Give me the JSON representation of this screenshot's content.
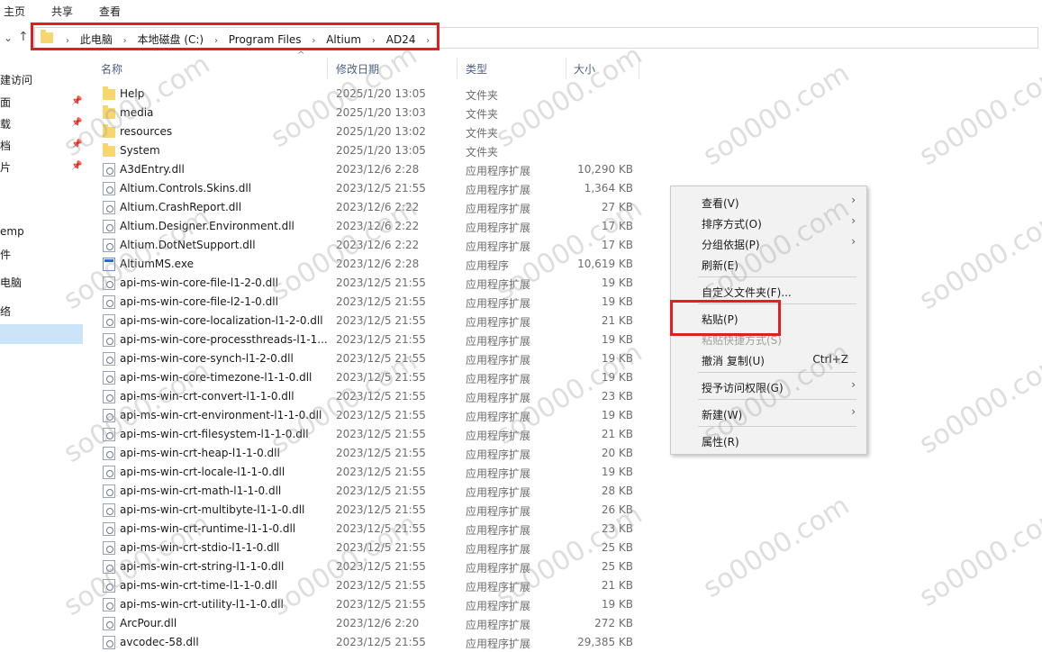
{
  "ribbon": {
    "tabs": [
      "主页",
      "共享",
      "查看"
    ]
  },
  "address": {
    "crumbs": [
      "此电脑",
      "本地磁盘 (C:)",
      "Program Files",
      "Altium",
      "AD24"
    ]
  },
  "nav_quick": [
    "建访问",
    "面",
    "载",
    "档",
    "片",
    "",
    "",
    "emp",
    "件"
  ],
  "nav_this_pc": "电脑",
  "nav_net": "络",
  "columns": {
    "name": "名称",
    "date": "修改日期",
    "type": "类型",
    "size": "大小"
  },
  "files": [
    {
      "name": "Help",
      "date": "2025/1/20 13:05",
      "type": "文件夹",
      "size": "",
      "icon": "folder"
    },
    {
      "name": "media",
      "date": "2025/1/20 13:03",
      "type": "文件夹",
      "size": "",
      "icon": "folder"
    },
    {
      "name": "resources",
      "date": "2025/1/20 13:02",
      "type": "文件夹",
      "size": "",
      "icon": "folder"
    },
    {
      "name": "System",
      "date": "2025/1/20 13:05",
      "type": "文件夹",
      "size": "",
      "icon": "folder"
    },
    {
      "name": "A3dEntry.dll",
      "date": "2023/12/6 2:28",
      "type": "应用程序扩展",
      "size": "10,290 KB",
      "icon": "dll"
    },
    {
      "name": "Altium.Controls.Skins.dll",
      "date": "2023/12/5 21:55",
      "type": "应用程序扩展",
      "size": "1,364 KB",
      "icon": "dll"
    },
    {
      "name": "Altium.CrashReport.dll",
      "date": "2023/12/6 2:22",
      "type": "应用程序扩展",
      "size": "27 KB",
      "icon": "dll"
    },
    {
      "name": "Altium.Designer.Environment.dll",
      "date": "2023/12/6 2:22",
      "type": "应用程序扩展",
      "size": "17 KB",
      "icon": "dll"
    },
    {
      "name": "Altium.DotNetSupport.dll",
      "date": "2023/12/6 2:22",
      "type": "应用程序扩展",
      "size": "17 KB",
      "icon": "dll"
    },
    {
      "name": "AltiumMS.exe",
      "date": "2023/12/6 2:28",
      "type": "应用程序",
      "size": "10,619 KB",
      "icon": "exe"
    },
    {
      "name": "api-ms-win-core-file-l1-2-0.dll",
      "date": "2023/12/5 21:55",
      "type": "应用程序扩展",
      "size": "19 KB",
      "icon": "dll"
    },
    {
      "name": "api-ms-win-core-file-l2-1-0.dll",
      "date": "2023/12/5 21:55",
      "type": "应用程序扩展",
      "size": "19 KB",
      "icon": "dll"
    },
    {
      "name": "api-ms-win-core-localization-l1-2-0.dll",
      "date": "2023/12/5 21:55",
      "type": "应用程序扩展",
      "size": "21 KB",
      "icon": "dll"
    },
    {
      "name": "api-ms-win-core-processthreads-l1-1...",
      "date": "2023/12/5 21:55",
      "type": "应用程序扩展",
      "size": "19 KB",
      "icon": "dll"
    },
    {
      "name": "api-ms-win-core-synch-l1-2-0.dll",
      "date": "2023/12/5 21:55",
      "type": "应用程序扩展",
      "size": "19 KB",
      "icon": "dll"
    },
    {
      "name": "api-ms-win-core-timezone-l1-1-0.dll",
      "date": "2023/12/5 21:55",
      "type": "应用程序扩展",
      "size": "19 KB",
      "icon": "dll"
    },
    {
      "name": "api-ms-win-crt-convert-l1-1-0.dll",
      "date": "2023/12/5 21:55",
      "type": "应用程序扩展",
      "size": "23 KB",
      "icon": "dll"
    },
    {
      "name": "api-ms-win-crt-environment-l1-1-0.dll",
      "date": "2023/12/5 21:55",
      "type": "应用程序扩展",
      "size": "19 KB",
      "icon": "dll"
    },
    {
      "name": "api-ms-win-crt-filesystem-l1-1-0.dll",
      "date": "2023/12/5 21:55",
      "type": "应用程序扩展",
      "size": "21 KB",
      "icon": "dll"
    },
    {
      "name": "api-ms-win-crt-heap-l1-1-0.dll",
      "date": "2023/12/5 21:55",
      "type": "应用程序扩展",
      "size": "20 KB",
      "icon": "dll"
    },
    {
      "name": "api-ms-win-crt-locale-l1-1-0.dll",
      "date": "2023/12/5 21:55",
      "type": "应用程序扩展",
      "size": "19 KB",
      "icon": "dll"
    },
    {
      "name": "api-ms-win-crt-math-l1-1-0.dll",
      "date": "2023/12/5 21:55",
      "type": "应用程序扩展",
      "size": "28 KB",
      "icon": "dll"
    },
    {
      "name": "api-ms-win-crt-multibyte-l1-1-0.dll",
      "date": "2023/12/5 21:55",
      "type": "应用程序扩展",
      "size": "26 KB",
      "icon": "dll"
    },
    {
      "name": "api-ms-win-crt-runtime-l1-1-0.dll",
      "date": "2023/12/5 21:55",
      "type": "应用程序扩展",
      "size": "23 KB",
      "icon": "dll"
    },
    {
      "name": "api-ms-win-crt-stdio-l1-1-0.dll",
      "date": "2023/12/5 21:55",
      "type": "应用程序扩展",
      "size": "25 KB",
      "icon": "dll"
    },
    {
      "name": "api-ms-win-crt-string-l1-1-0.dll",
      "date": "2023/12/5 21:55",
      "type": "应用程序扩展",
      "size": "25 KB",
      "icon": "dll"
    },
    {
      "name": "api-ms-win-crt-time-l1-1-0.dll",
      "date": "2023/12/5 21:55",
      "type": "应用程序扩展",
      "size": "21 KB",
      "icon": "dll"
    },
    {
      "name": "api-ms-win-crt-utility-l1-1-0.dll",
      "date": "2023/12/5 21:55",
      "type": "应用程序扩展",
      "size": "19 KB",
      "icon": "dll"
    },
    {
      "name": "ArcPour.dll",
      "date": "2023/12/6 2:20",
      "type": "应用程序扩展",
      "size": "272 KB",
      "icon": "dll"
    },
    {
      "name": "avcodec-58.dll",
      "date": "2023/12/5 21:55",
      "type": "应用程序扩展",
      "size": "29,385 KB",
      "icon": "dll"
    }
  ],
  "context_menu": {
    "view": "查看(V)",
    "sort": "排序方式(O)",
    "group": "分组依据(P)",
    "refresh": "刷新(E)",
    "customize": "自定义文件夹(F)...",
    "paste": "粘贴(P)",
    "paste_shortcut": "粘贴快捷方式(S)",
    "undo_copy": "撤消 复制(U)",
    "undo_shortcut": "Ctrl+Z",
    "grant_access": "授予访问权限(G)",
    "new": "新建(W)",
    "properties": "属性(R)"
  },
  "watermark": "so0000.com"
}
